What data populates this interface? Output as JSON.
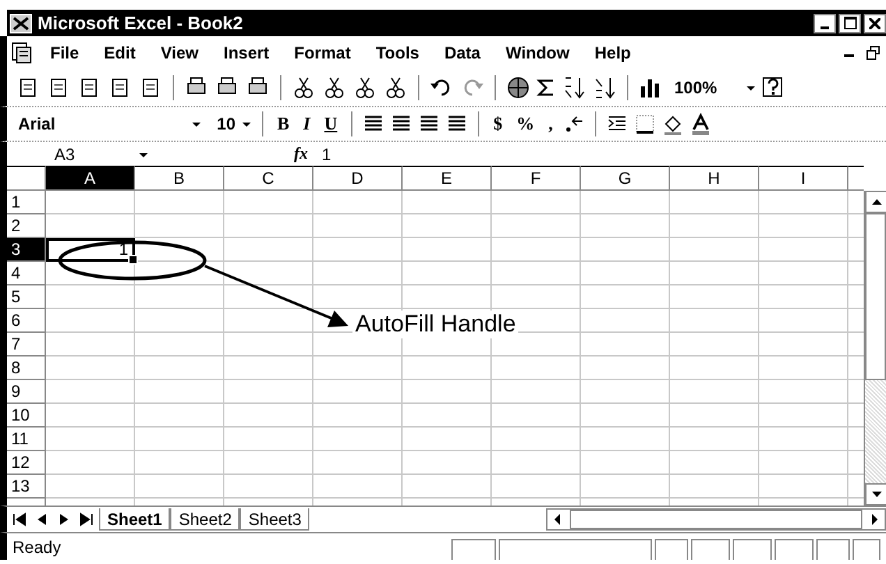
{
  "window": {
    "title": "Microsoft Excel - Book2"
  },
  "menu": [
    {
      "label": "File"
    },
    {
      "label": "Edit"
    },
    {
      "label": "View"
    },
    {
      "label": "Insert"
    },
    {
      "label": "Format"
    },
    {
      "label": "Tools"
    },
    {
      "label": "Data"
    },
    {
      "label": "Window"
    },
    {
      "label": "Help"
    }
  ],
  "toolbar": {
    "zoom": "100%"
  },
  "format_toolbar": {
    "font": "Arial",
    "size": "10",
    "bold": "B",
    "italic": "I",
    "underline": "U",
    "currency": "$",
    "percent": "%",
    "comma": ","
  },
  "formula_bar": {
    "name_box": "A3",
    "fx": "fx",
    "formula": "1"
  },
  "columns": [
    {
      "label": "A",
      "selected": true
    },
    {
      "label": "B",
      "selected": false
    },
    {
      "label": "C",
      "selected": false
    },
    {
      "label": "D",
      "selected": false
    },
    {
      "label": "E",
      "selected": false
    },
    {
      "label": "F",
      "selected": false
    },
    {
      "label": "G",
      "selected": false
    },
    {
      "label": "H",
      "selected": false
    },
    {
      "label": "I",
      "selected": false
    }
  ],
  "rows": [
    {
      "label": "1",
      "selected": false
    },
    {
      "label": "2",
      "selected": false
    },
    {
      "label": "3",
      "selected": true,
      "cell_a": "1"
    },
    {
      "label": "4",
      "selected": false
    },
    {
      "label": "5",
      "selected": false
    },
    {
      "label": "6",
      "selected": false
    },
    {
      "label": "7",
      "selected": false
    },
    {
      "label": "8",
      "selected": false
    },
    {
      "label": "9",
      "selected": false
    },
    {
      "label": "10",
      "selected": false
    },
    {
      "label": "11",
      "selected": false
    },
    {
      "label": "12",
      "selected": false
    },
    {
      "label": "13",
      "selected": false
    }
  ],
  "annotation": "AutoFill Handle",
  "sheets": [
    {
      "label": "Sheet1",
      "selected": true
    },
    {
      "label": "Sheet2",
      "selected": false
    },
    {
      "label": "Sheet3",
      "selected": false
    }
  ],
  "status_bar": {
    "text": "Ready"
  }
}
